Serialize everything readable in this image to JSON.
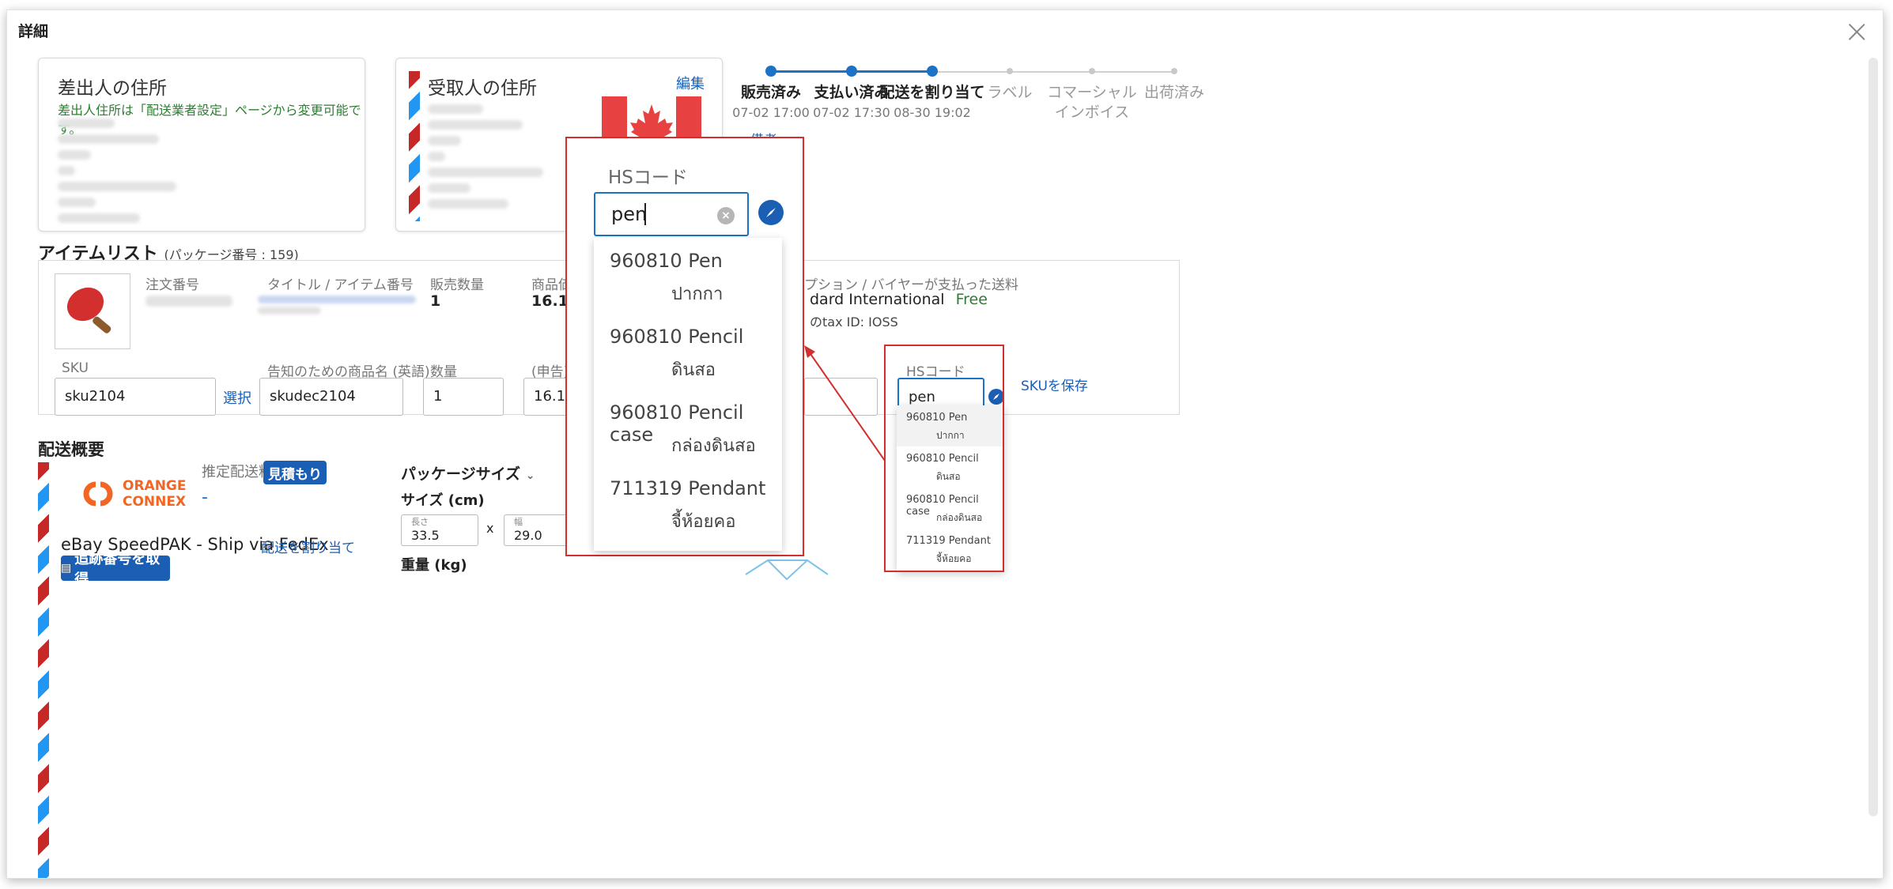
{
  "modal": {
    "title": "詳細",
    "close": "×"
  },
  "sender": {
    "title": "差出人の住所",
    "note": "差出人住所は「配送業者設定」ページから変更可能です。"
  },
  "recipient": {
    "title": "受取人の住所",
    "edit": "編集"
  },
  "steps": [
    {
      "label": "販売済み",
      "time": "07-02 17:00",
      "done": true
    },
    {
      "label": "支払い済み",
      "time": "07-02 17:30",
      "done": true
    },
    {
      "label": "配送を割り当て",
      "time": "08-30 19:02",
      "done": true
    },
    {
      "label": "ラベル",
      "time": "",
      "done": false
    },
    {
      "label": "コマーシャルインボイス",
      "time": "",
      "done": false
    },
    {
      "label": "出荷済み",
      "time": "",
      "done": false
    }
  ],
  "remark_link": "備考",
  "item_list": {
    "title": "アイテムリスト",
    "package_note": "(パッケージ番号 : 159)",
    "col_order": "注文番号",
    "col_title": "タイトル / アイテム番号",
    "col_qty": "販売数量",
    "col_price": "商品価格",
    "col_shipping": "プション / バイヤーが支払った送料",
    "qty_value": "1",
    "price_value": "16.13 U",
    "shipping_value": "dard International",
    "shipping_free": "Free",
    "tax_note": "のtax ID: IOSS",
    "sku_label": "SKU",
    "sku_value": "sku2104",
    "sku_select": "選択",
    "declare_label": "告知のための商品名 (英語)",
    "declare_value": "skudec2104",
    "qty_label": "数量",
    "qty_input": "1",
    "unit_label": "(申告)単",
    "unit_value": "16.13",
    "hs_label": "HSコード",
    "hs_value": "pen",
    "save_sku": "SKUを保存",
    "hs_options": [
      {
        "code": "960810 Pen",
        "thai": "ปากกา"
      },
      {
        "code": "960810 Pencil",
        "thai": "ดินสอ"
      },
      {
        "code": "960810 Pencil case",
        "thai": "กล่องดินสอ"
      },
      {
        "code": "711319 Pendant",
        "thai": "จี้ห้อยคอ"
      }
    ]
  },
  "zoom": {
    "label": "HSコード",
    "value": "pen",
    "options": [
      {
        "code": "960810 Pen",
        "thai": "ปากกา"
      },
      {
        "code": "960810 Pencil",
        "thai": "ดินสอ"
      },
      {
        "code": "960810 Pencil case",
        "thai": "กล่องดินสอ"
      },
      {
        "code": "711319 Pendant",
        "thai": "จี้ห้อยคอ"
      }
    ]
  },
  "shipping": {
    "title": "配送概要",
    "carrier_top": "ORANGE",
    "carrier_bottom": "CONNEX",
    "est_label": "推定配送料",
    "estimate_btn": "見積もり",
    "est_value": "-",
    "service": "eBay SpeedPAK - Ship via FedEx",
    "assign_link": "配送を割り当て",
    "tracking_btn": "追跡番号を取得",
    "pkg_size": "パッケージサイズ",
    "size_label": "サイズ (cm)",
    "length_label": "長さ",
    "length_value": "33.5",
    "x": "x",
    "width_label": "幅",
    "width_value": "29.0",
    "weight_label": "重量 (kg)"
  },
  "colors": {
    "accent": "#1a5fb4",
    "callout": "#d32f2f",
    "progress": "#1a73c6",
    "green": "#2e7d32"
  }
}
